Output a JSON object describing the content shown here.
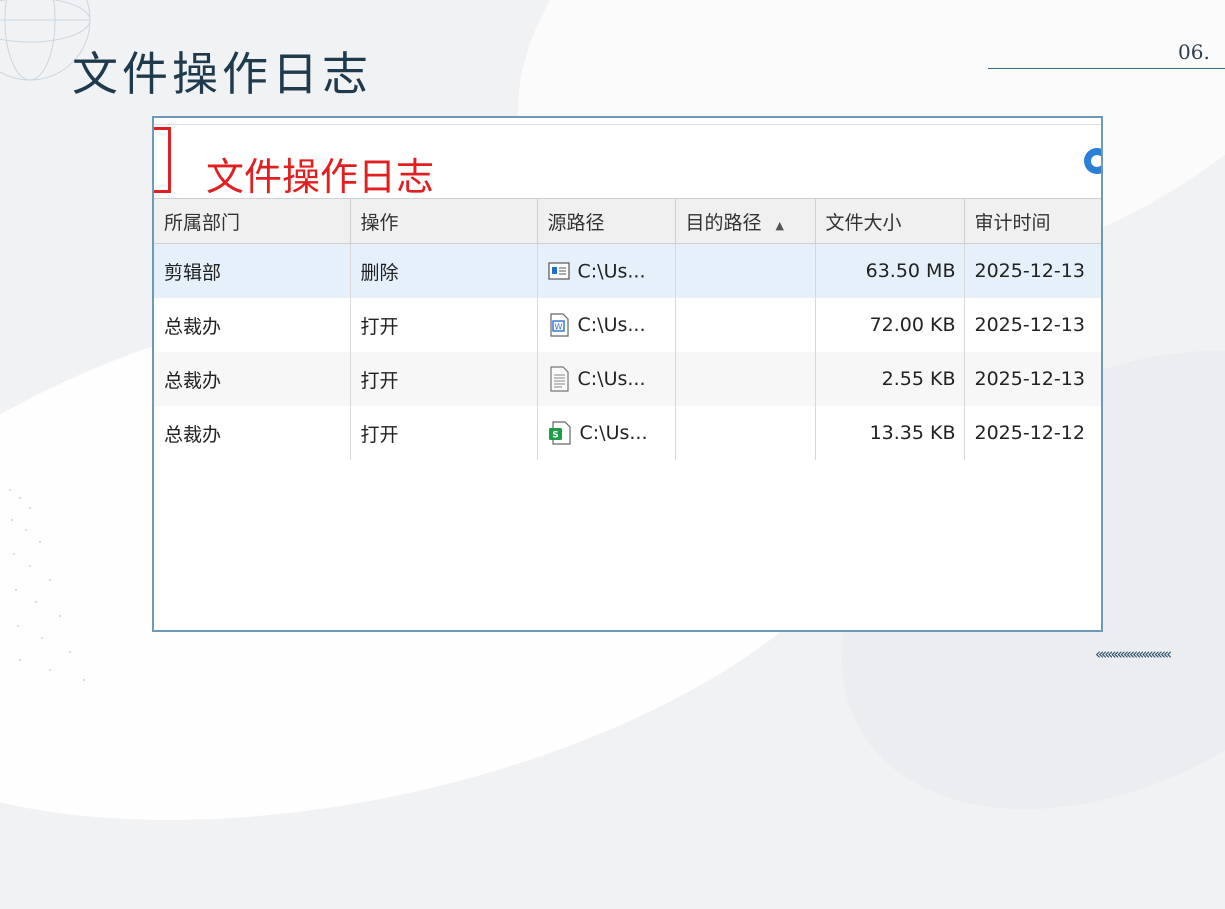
{
  "slide": {
    "title": "文件操作日志",
    "page_number": "06.",
    "chevrons": "««««««««««««"
  },
  "app": {
    "title": "文件操作日志",
    "accent_color": "#e02020"
  },
  "table": {
    "columns": [
      "所属部门",
      "操作",
      "源路径",
      "目的路径",
      "文件大小",
      "审计时间"
    ],
    "sorted_column": "目的路径",
    "sort_direction": "ascending",
    "rows": [
      {
        "department": "剪辑部",
        "operation": "删除",
        "icon": "window-file-icon",
        "source": "C:\\Us...",
        "dest": "",
        "size": "63.50 MB",
        "time": "2025-12-13"
      },
      {
        "department": "总裁办",
        "operation": "打开",
        "icon": "word-doc-icon",
        "source": "C:\\Us...",
        "dest": "",
        "size": "72.00 KB",
        "time": "2025-12-13"
      },
      {
        "department": "总裁办",
        "operation": "打开",
        "icon": "text-file-icon",
        "source": "C:\\Us...",
        "dest": "",
        "size": "2.55 KB",
        "time": "2025-12-13"
      },
      {
        "department": "总裁办",
        "operation": "打开",
        "icon": "spreadsheet-icon",
        "source": "C:\\Us...",
        "dest": "",
        "size": "13.35 KB",
        "time": "2025-12-12"
      }
    ]
  }
}
